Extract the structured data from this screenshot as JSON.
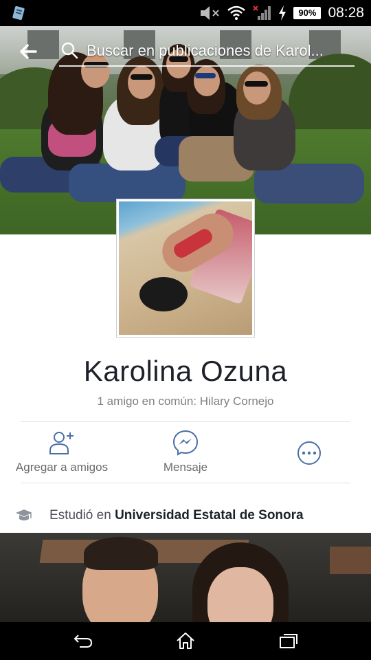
{
  "status_bar": {
    "battery": "90%",
    "time": "08:28"
  },
  "header": {
    "search_placeholder": "Buscar en publicaciones de Karol..."
  },
  "profile": {
    "name": "Karolina Ozuna",
    "mutual_friends": "1 amigo en común: Hilary Cornejo"
  },
  "actions": {
    "add_friend": "Agregar a amigos",
    "message": "Mensaje"
  },
  "education": {
    "prefix": "Estudió en ",
    "school": "Universidad Estatal de Sonora"
  },
  "icons": {
    "back": "back-arrow-icon",
    "search": "search-icon",
    "add_friend": "add-friend-icon",
    "messenger": "messenger-icon",
    "more": "more-options-icon",
    "education": "graduation-cap-icon"
  },
  "colors": {
    "accent_icon": "#4a6fa5",
    "text_primary": "#1d2129",
    "text_secondary": "#7f7f7f"
  }
}
